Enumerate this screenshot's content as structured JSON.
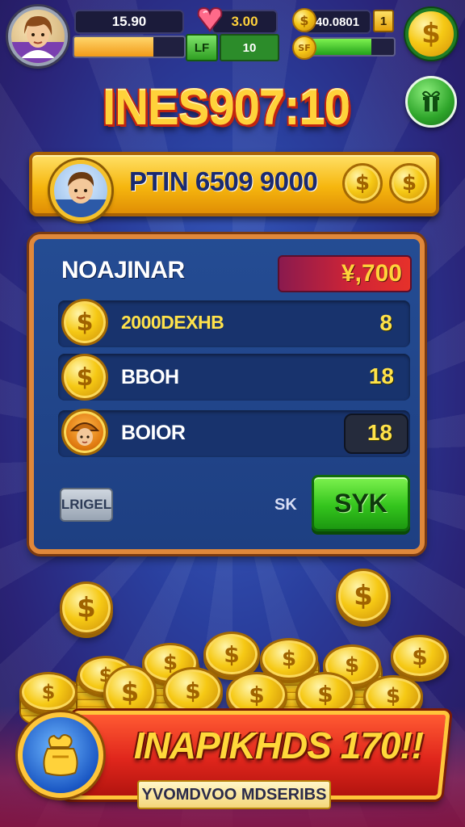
{
  "hud": {
    "top_value": "15.90",
    "level_label": "LF",
    "level_value": "10",
    "gem_value": "3.00",
    "coin_value": "40.0801",
    "coin_badge": "1",
    "bar_badge": "SF",
    "xp_progress": 0.72,
    "green_progress": 0.75
  },
  "title": "INES907:10",
  "banner": {
    "text": "PTIN 6509 9000"
  },
  "panel": {
    "title": "NOAJINAR",
    "total": "¥,700",
    "rows": [
      {
        "label": "2000DEXHB",
        "value": "8"
      },
      {
        "label": "BBOH",
        "value": "18"
      },
      {
        "label": "BOIOR",
        "value": "18"
      }
    ],
    "cancel_label": "LRIGEL",
    "sk_label": "SK",
    "confirm_label": "SYK"
  },
  "bottom": {
    "title": "INAPIKHDS 170!!",
    "subtitle": "YVOMDVOO MDSERIBS"
  },
  "icons": {
    "coin": "dollar-coin-icon",
    "avatar": "player-avatar-icon",
    "bag": "reward-bag-icon"
  },
  "colors": {
    "gold": "#f6c915",
    "green": "#34c51d",
    "red": "#e0261c",
    "panel_blue": "#1e3f82"
  }
}
